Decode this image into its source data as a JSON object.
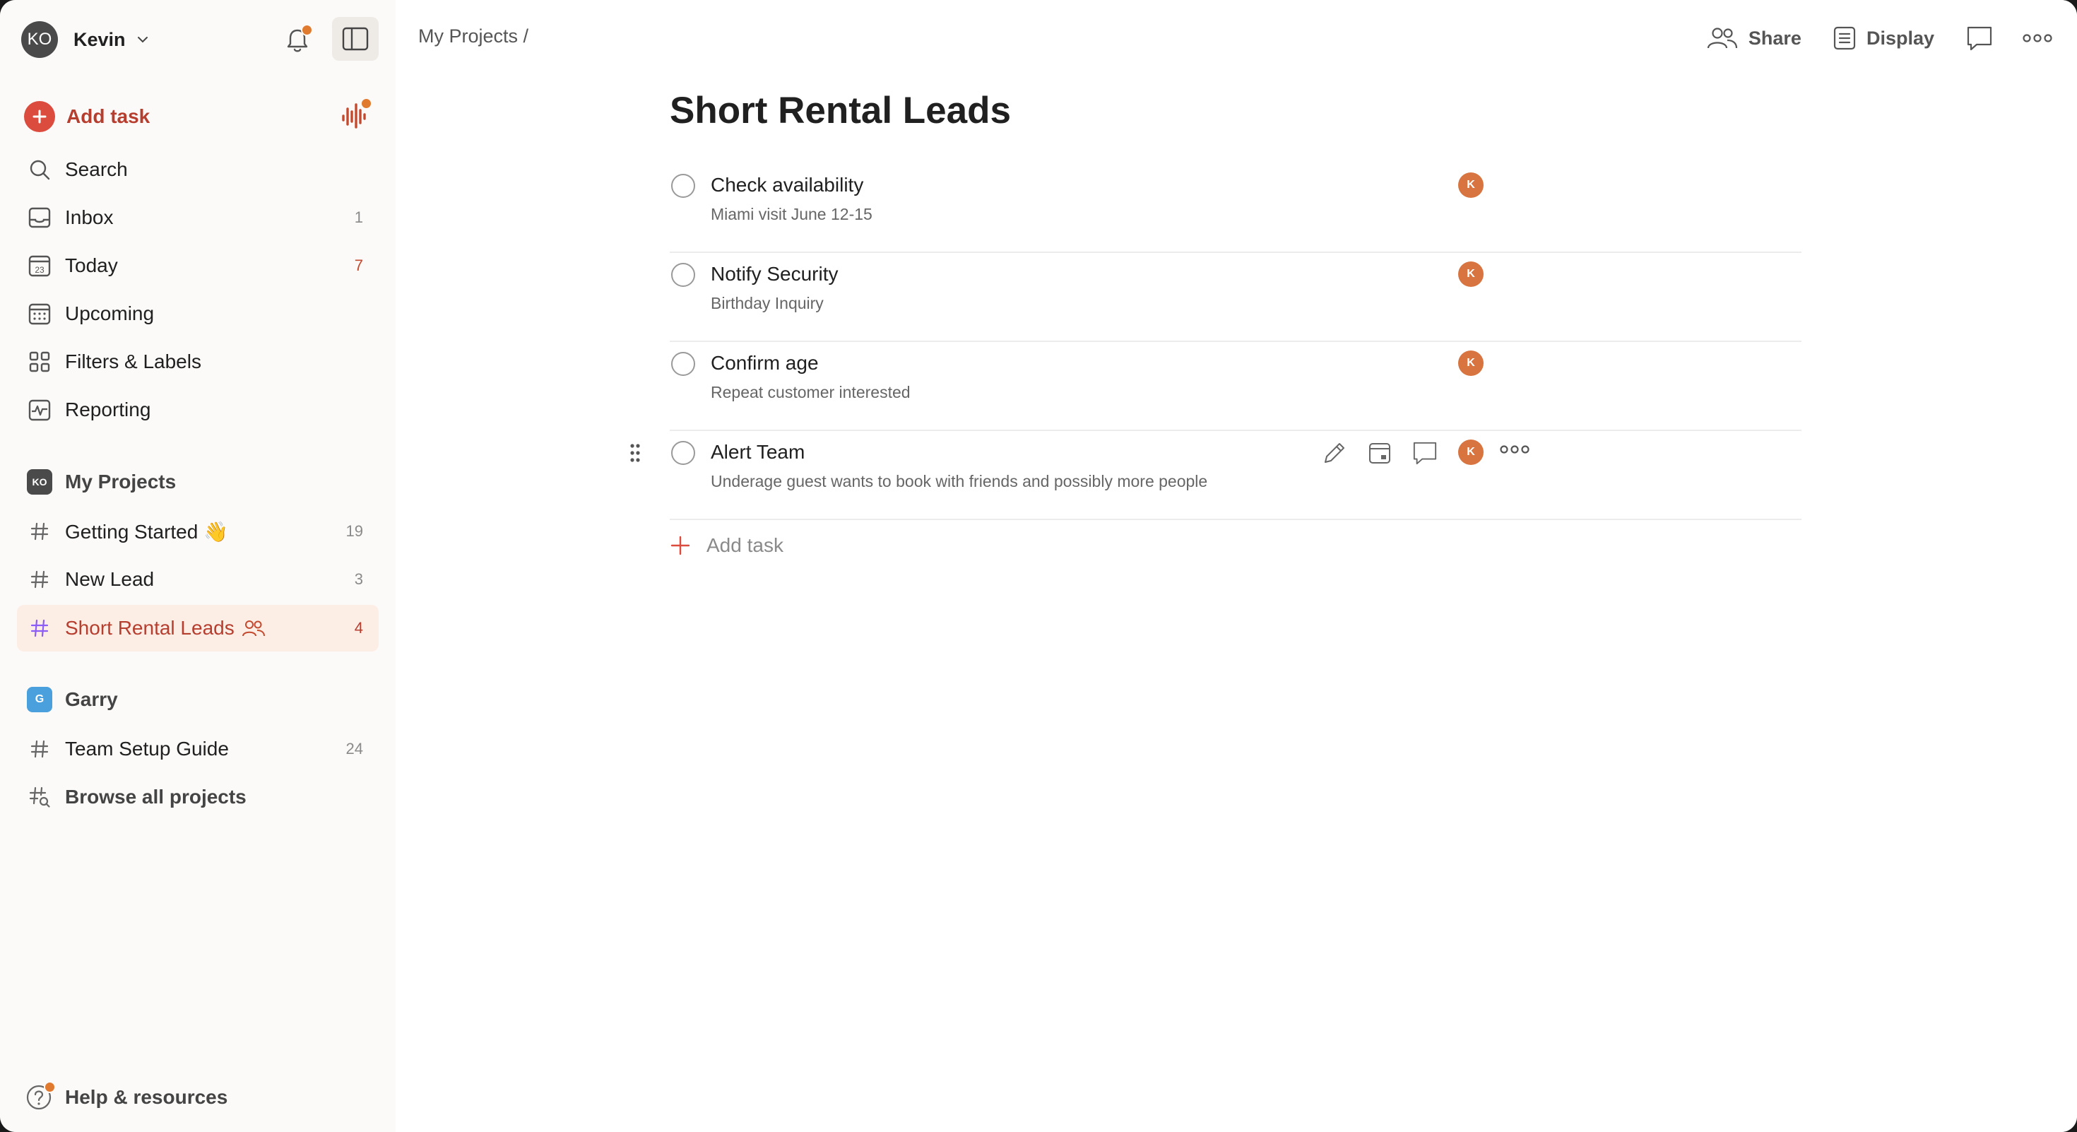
{
  "user": {
    "initials": "KO",
    "name": "Kevin"
  },
  "sidebar": {
    "add_task_label": "Add task",
    "nav": [
      {
        "label": "Search",
        "count": ""
      },
      {
        "label": "Inbox",
        "count": "1"
      },
      {
        "label": "Today",
        "count": "7",
        "date_glyph": "23"
      },
      {
        "label": "Upcoming",
        "count": ""
      },
      {
        "label": "Filters & Labels",
        "count": ""
      },
      {
        "label": "Reporting",
        "count": ""
      }
    ],
    "my_projects": {
      "badge": "KO",
      "label": "My Projects",
      "items": [
        {
          "label": "Getting Started 👋",
          "count": "19"
        },
        {
          "label": "New Lead",
          "count": "3"
        },
        {
          "label": "Short Rental Leads",
          "count": "4"
        }
      ]
    },
    "team": {
      "badge": "G",
      "label": "Garry",
      "items": [
        {
          "label": "Team Setup Guide",
          "count": "24"
        }
      ]
    },
    "browse_label": "Browse all projects",
    "help_label": "Help & resources"
  },
  "header": {
    "breadcrumb": "My Projects /",
    "share_label": "Share",
    "display_label": "Display"
  },
  "page": {
    "title": "Short Rental Leads",
    "tasks": [
      {
        "title": "Check availability",
        "description": "Miami visit June 12-15",
        "assignee": "K"
      },
      {
        "title": "Notify Security",
        "description": "Birthday Inquiry",
        "assignee": "K"
      },
      {
        "title": "Confirm age",
        "description": "Repeat customer interested",
        "assignee": "K"
      },
      {
        "title": "Alert Team",
        "description": "Underage guest wants to book with friends and possibly more people",
        "assignee": "K"
      }
    ],
    "add_task_label": "Add task"
  },
  "colors": {
    "accent": "#dc4c3e",
    "active_bg": "#fdeee5",
    "sidebar_bg": "#fcfaf8",
    "notification_dot": "#e07a2e",
    "assignee": "#d8743f",
    "team_badge": "#4a9fdd"
  }
}
